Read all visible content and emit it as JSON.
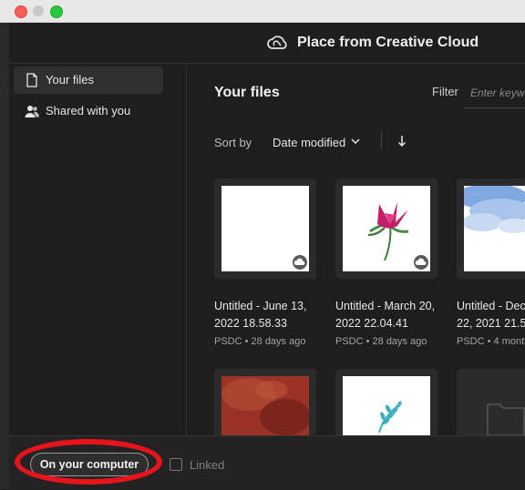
{
  "window": {
    "title": "Place from Creative Cloud"
  },
  "sidebar": {
    "items": [
      {
        "label": "Your files",
        "icon": "document-icon",
        "active": true
      },
      {
        "label": "Shared with you",
        "icon": "people-icon",
        "active": false
      }
    ]
  },
  "main": {
    "title": "Your files",
    "filter": {
      "label": "Filter",
      "placeholder": "Enter keywo"
    },
    "sort": {
      "label": "Sort by",
      "value": "Date modified",
      "direction_icon": "arrow-down-icon"
    }
  },
  "files": [
    {
      "name_line1": "Untitled - June 13,",
      "name_line2": "2022 18.58.33",
      "meta": "PSDC • 28 days ago",
      "thumb": "blank"
    },
    {
      "name_line1": "Untitled - March 20,",
      "name_line2": "2022 22.04.41",
      "meta": "PSDC • 28 days ago",
      "thumb": "flower"
    },
    {
      "name_line1": "Untitled - Dec",
      "name_line2": "22, 2021 21.54.4",
      "meta": "PSDC • 4 months",
      "thumb": "watercolor"
    },
    {
      "thumb": "red-texture"
    },
    {
      "thumb": "leaf"
    },
    {
      "thumb": "folder"
    }
  ],
  "footer": {
    "source_button": "On your computer",
    "linked_label": "Linked"
  },
  "colors": {
    "highlight_ring": "#e8141b",
    "background": "#1e1e1e"
  }
}
